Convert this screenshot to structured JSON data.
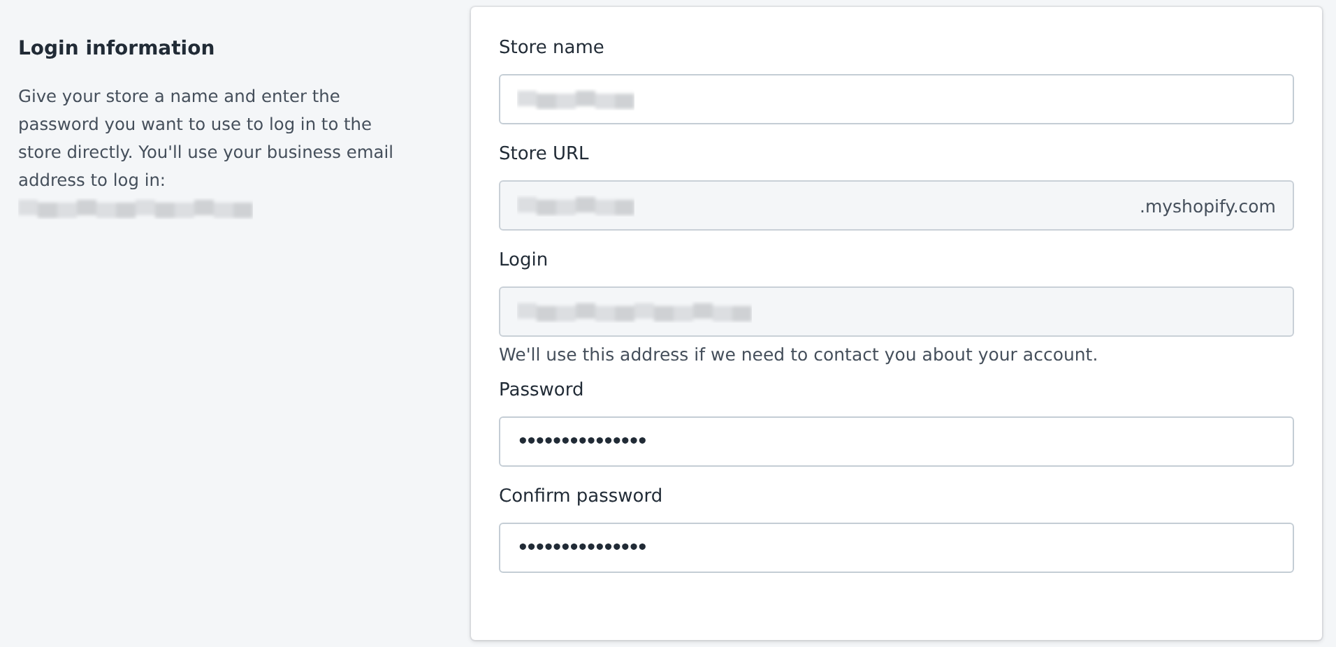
{
  "section": {
    "title": "Login information",
    "description": "Give your store a name and enter the password you want to use to log in to the store directly. You'll use your business email address to log in:",
    "description_value_blurred": true
  },
  "fields": [
    {
      "label": "Store name",
      "kind": "text",
      "value_blurred": true,
      "readonly": false
    },
    {
      "label": "Store URL",
      "kind": "suffix",
      "suffix": ".myshopify.com",
      "value_blurred": true,
      "readonly": true
    },
    {
      "label": "Login",
      "kind": "text",
      "value_blurred": true,
      "readonly": true,
      "help": "We'll use this address if we need to contact you about your account."
    },
    {
      "label": "Password",
      "kind": "password",
      "value": "•••••••••••••••"
    },
    {
      "label": "Confirm password",
      "kind": "password",
      "value": "•••••••••••••••"
    }
  ]
}
